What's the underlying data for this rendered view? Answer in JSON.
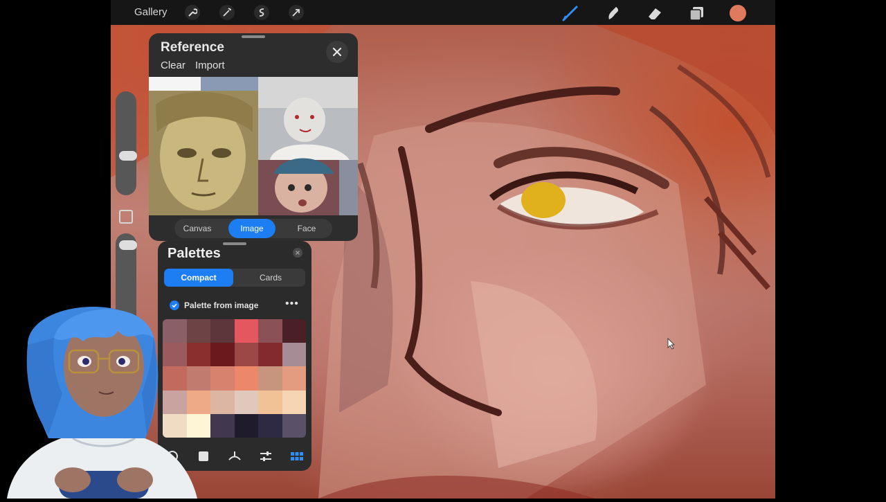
{
  "topbar": {
    "gallery_label": "Gallery",
    "left_tools": [
      "wrench-icon",
      "magic-wand-icon",
      "selection-icon",
      "transform-arrow-icon"
    ],
    "right_tools": [
      "brush-icon",
      "smudge-icon",
      "eraser-icon",
      "layers-icon"
    ],
    "current_color": "#e07a5f",
    "accent_color": "#1c7ef2"
  },
  "reference": {
    "title": "Reference",
    "clear_label": "Clear",
    "import_label": "Import",
    "tabs": [
      {
        "label": "Canvas",
        "active": false
      },
      {
        "label": "Image",
        "active": true
      },
      {
        "label": "Face",
        "active": false
      }
    ]
  },
  "palettes": {
    "title": "Palettes",
    "tabs": [
      {
        "label": "Compact",
        "active": true
      },
      {
        "label": "Cards",
        "active": false
      }
    ],
    "palette_name": "Palette from image",
    "swatches": [
      "#8a6066",
      "#6e4346",
      "#5c363a",
      "#e4575e",
      "#8a5157",
      "#4a1f26",
      "#9b5a5d",
      "#8a2e2e",
      "#6a1a1d",
      "#9c4846",
      "#822a2c",
      "#a58c95",
      "#c16a5d",
      "#c27c6f",
      "#d6826e",
      "#ec8869",
      "#c7957d",
      "#e39c80",
      "#c8a3a0",
      "#eeaa86",
      "#dcb6a3",
      "#e1c8bd",
      "#f0c296",
      "#f6d5b3",
      "#efdcc3",
      "#fdf5d5",
      "#41384f",
      "#1f1a2c",
      "#2f2a44",
      "#5a5168"
    ],
    "footer_icons": [
      "circle-icon",
      "square-icon",
      "curve-tool-icon",
      "sliders-icon",
      "grid-icon"
    ]
  }
}
